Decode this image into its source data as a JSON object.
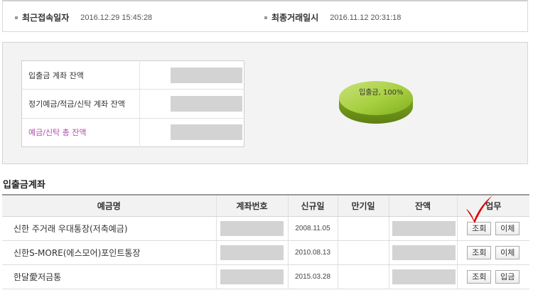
{
  "login_info": {
    "recent_login_label": "최근접속일자",
    "recent_login_value": "2016.12.29 15:45:28",
    "last_transaction_label": "최종거래일시",
    "last_transaction_value": "2016.11.12 20:31:18"
  },
  "summary": {
    "rows": [
      {
        "label": "입출금 계좌 잔액"
      },
      {
        "label": "정기예금/적금/신탁 계좌 잔액"
      },
      {
        "label": "예금/신탁 총 잔액"
      }
    ],
    "total_label_color": "#b24ba8"
  },
  "pie": {
    "label": "입출금, 100%",
    "color": "#8fbf2a"
  },
  "section_title": "입출금계좌",
  "table": {
    "headers": [
      "예금명",
      "계좌번호",
      "신규일",
      "만기일",
      "잔액",
      "업무"
    ],
    "rows": [
      {
        "name": "신한 주거래 우대통장(저축예금)",
        "opened": "2008.11.05",
        "maturity": "",
        "buttons": [
          "조회",
          "이체"
        ]
      },
      {
        "name": "신한S-MORE(에스모어)포인트통장",
        "opened": "2010.08.13",
        "maturity": "",
        "buttons": [
          "조회",
          "이체"
        ]
      },
      {
        "name": "한달愛저금통",
        "opened": "2015.03.28",
        "maturity": "",
        "buttons": [
          "조회",
          "입금"
        ]
      }
    ]
  },
  "annotation": {
    "mark": "checkmark",
    "color": "#e00000"
  }
}
